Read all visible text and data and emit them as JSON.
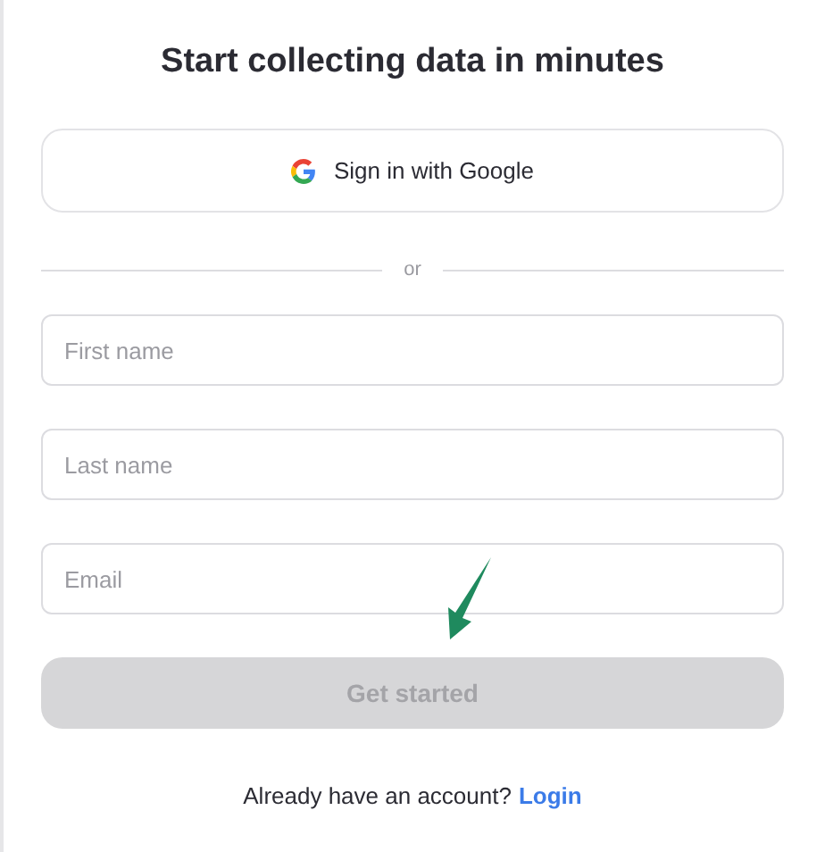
{
  "title": "Start collecting data in minutes",
  "google_button": {
    "label": "Sign in with Google"
  },
  "divider": {
    "label": "or"
  },
  "fields": [
    {
      "placeholder": "First name"
    },
    {
      "placeholder": "Last name"
    },
    {
      "placeholder": "Email"
    }
  ],
  "submit_button": {
    "label": "Get started",
    "disabled": true
  },
  "footer": {
    "text": "Already have an account?",
    "link": "Login"
  }
}
